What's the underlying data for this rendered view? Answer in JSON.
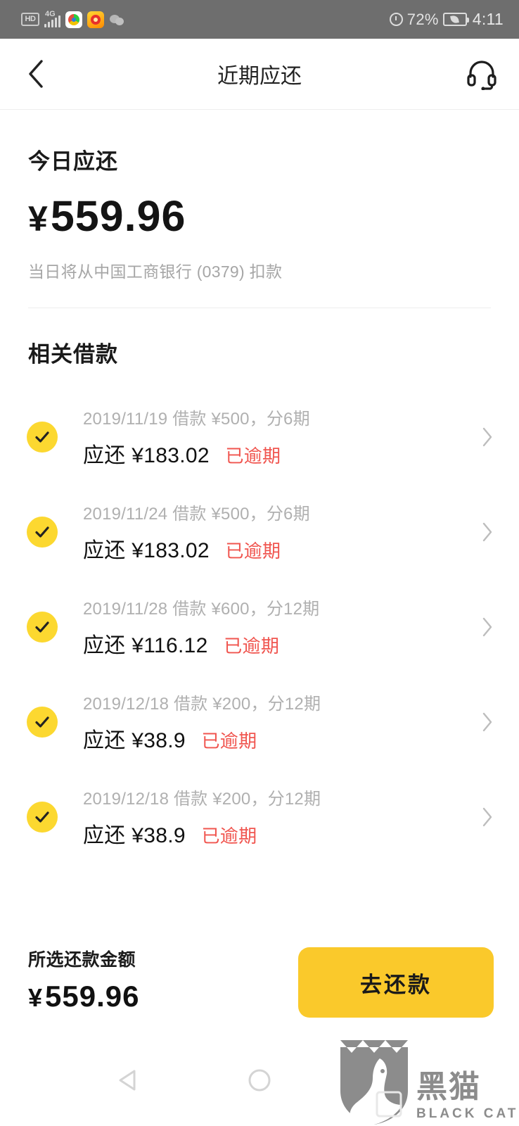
{
  "status_bar": {
    "hd_label": "HD",
    "network_label": "4G",
    "battery_percent": "72%",
    "time": "4:11",
    "icons": [
      "hd-icon",
      "signal-icon",
      "chrome-app-icon",
      "weibo-app-icon",
      "wechat-app-icon",
      "alarm-icon",
      "battery-icon"
    ]
  },
  "header": {
    "back_icon": "chevron-left-icon",
    "title": "近期应还",
    "support_icon": "headset-icon"
  },
  "summary": {
    "title": "今日应还",
    "currency": "¥",
    "amount": "559.96",
    "note": "当日将从中国工商银行 (0379) 扣款"
  },
  "loans_section": {
    "title": "相关借款",
    "items": [
      {
        "meta": "2019/11/19 借款 ¥500，分6期",
        "due_label": "应还",
        "due_currency": "¥",
        "due_amount": "183.02",
        "status": "已逾期",
        "checked": true
      },
      {
        "meta": "2019/11/24 借款 ¥500，分6期",
        "due_label": "应还",
        "due_currency": "¥",
        "due_amount": "183.02",
        "status": "已逾期",
        "checked": true
      },
      {
        "meta": "2019/11/28 借款 ¥600，分12期",
        "due_label": "应还",
        "due_currency": "¥",
        "due_amount": "116.12",
        "status": "已逾期",
        "checked": true
      },
      {
        "meta": "2019/12/18 借款 ¥200，分12期",
        "due_label": "应还",
        "due_currency": "¥",
        "due_amount": "38.9",
        "status": "已逾期",
        "checked": true
      },
      {
        "meta": "2019/12/18 借款 ¥200，分12期",
        "due_label": "应还",
        "due_currency": "¥",
        "due_amount": "38.9",
        "status": "已逾期",
        "checked": true
      }
    ]
  },
  "pay_bar": {
    "label": "所选还款金额",
    "currency": "¥",
    "amount": "559.96",
    "button_label": "去还款"
  },
  "nav_bar": {
    "back_icon": "triangle-back-icon",
    "home_icon": "circle-home-icon",
    "recents_icon": "square-recents-icon"
  },
  "watermark": {
    "cn": "黑猫",
    "en": "BLACK CAT",
    "logo_icon": "black-cat-shield-icon"
  },
  "colors": {
    "accent_yellow": "#FAC92B",
    "check_yellow": "#FCD830",
    "overdue_red": "#f0554f",
    "status_bar_gray": "#6e6e6e",
    "muted_text": "#b0b0b0"
  }
}
